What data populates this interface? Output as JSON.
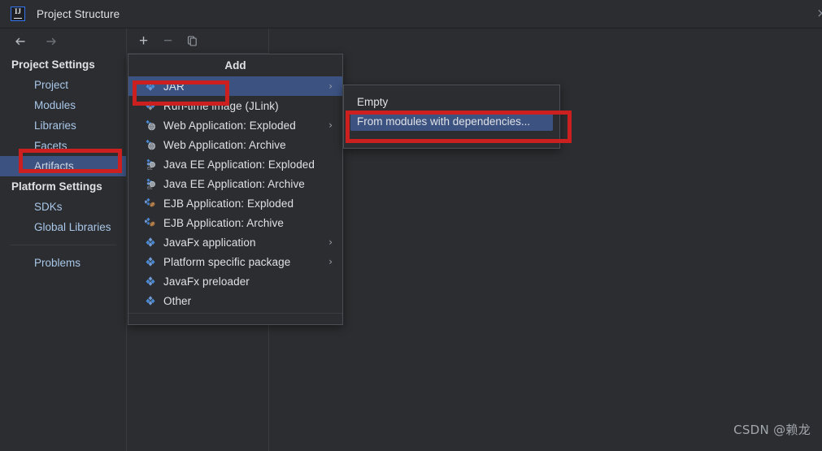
{
  "window": {
    "app_icon": "intellij-idea-logo",
    "app_icon_text": "IJ",
    "title": "Project Structure",
    "close_label": "×"
  },
  "nav": {
    "back_icon": "arrow-left-icon",
    "forward_icon": "arrow-right-icon"
  },
  "sidebar": {
    "groups": [
      {
        "label": "Project Settings",
        "items": [
          {
            "label": "Project",
            "selected": false
          },
          {
            "label": "Modules",
            "selected": false
          },
          {
            "label": "Libraries",
            "selected": false
          },
          {
            "label": "Facets",
            "selected": false
          },
          {
            "label": "Artifacts",
            "selected": true
          }
        ]
      },
      {
        "label": "Platform Settings",
        "items": [
          {
            "label": "SDKs",
            "selected": false
          },
          {
            "label": "Global Libraries",
            "selected": false
          }
        ]
      }
    ],
    "footer_items": [
      {
        "label": "Problems",
        "selected": false
      }
    ]
  },
  "toolbar": {
    "buttons": [
      {
        "name": "add-button",
        "icon": "plus-icon",
        "glyph": "+",
        "enabled": true
      },
      {
        "name": "remove-button",
        "icon": "minus-icon",
        "glyph": "−",
        "enabled": false
      },
      {
        "name": "copy-button",
        "icon": "copy-icon",
        "glyph": "",
        "enabled": true
      }
    ]
  },
  "add_menu": {
    "title": "Add",
    "items": [
      {
        "label": "JAR",
        "icon": "artifact-diamond-icon",
        "selected": true,
        "submenu": true
      },
      {
        "label": "Run-time image (JLink)",
        "icon": "artifact-diamond-icon",
        "selected": false,
        "submenu": false
      },
      {
        "label": "Web Application: Exploded",
        "icon": "web-application-globe-icon",
        "selected": false,
        "submenu": true
      },
      {
        "label": "Web Application: Archive",
        "icon": "web-application-globe-icon",
        "selected": false,
        "submenu": false
      },
      {
        "label": "Java EE Application: Exploded",
        "icon": "java-ee-application-icon",
        "selected": false,
        "submenu": false
      },
      {
        "label": "Java EE Application: Archive",
        "icon": "java-ee-application-icon",
        "selected": false,
        "submenu": false
      },
      {
        "label": "EJB Application: Exploded",
        "icon": "ejb-application-bean-icon",
        "selected": false,
        "submenu": false
      },
      {
        "label": "EJB Application: Archive",
        "icon": "ejb-application-bean-icon",
        "selected": false,
        "submenu": false
      },
      {
        "label": "JavaFx application",
        "icon": "artifact-diamond-icon",
        "selected": false,
        "submenu": true
      },
      {
        "label": "Platform specific package",
        "icon": "artifact-diamond-icon",
        "selected": false,
        "submenu": true
      },
      {
        "label": "JavaFx preloader",
        "icon": "artifact-diamond-icon",
        "selected": false,
        "submenu": false
      },
      {
        "label": "Other",
        "icon": "artifact-diamond-icon",
        "selected": false,
        "submenu": false
      }
    ],
    "submenu_arrow": "›"
  },
  "jar_submenu": {
    "items": [
      {
        "label": "Empty",
        "selected": false
      },
      {
        "label": "From modules with dependencies...",
        "selected": true
      }
    ]
  },
  "annotations": {
    "boxes": [
      {
        "name": "highlight-jar",
        "color": "#cc1f1f"
      },
      {
        "name": "highlight-artifacts",
        "color": "#cc1f1f"
      },
      {
        "name": "highlight-from-modules-with-deps",
        "color": "#cc1f1f"
      }
    ]
  },
  "watermark": {
    "text": "CSDN @赖龙"
  },
  "colors": {
    "background": "#2b2d30",
    "panel_border": "#393b40",
    "selection_blue": "#3c5280",
    "link_text": "#a9c7e8",
    "primary_text": "#dfe1e5",
    "annotation_red": "#cc1f1f",
    "accent_blue": "#3574f0"
  }
}
